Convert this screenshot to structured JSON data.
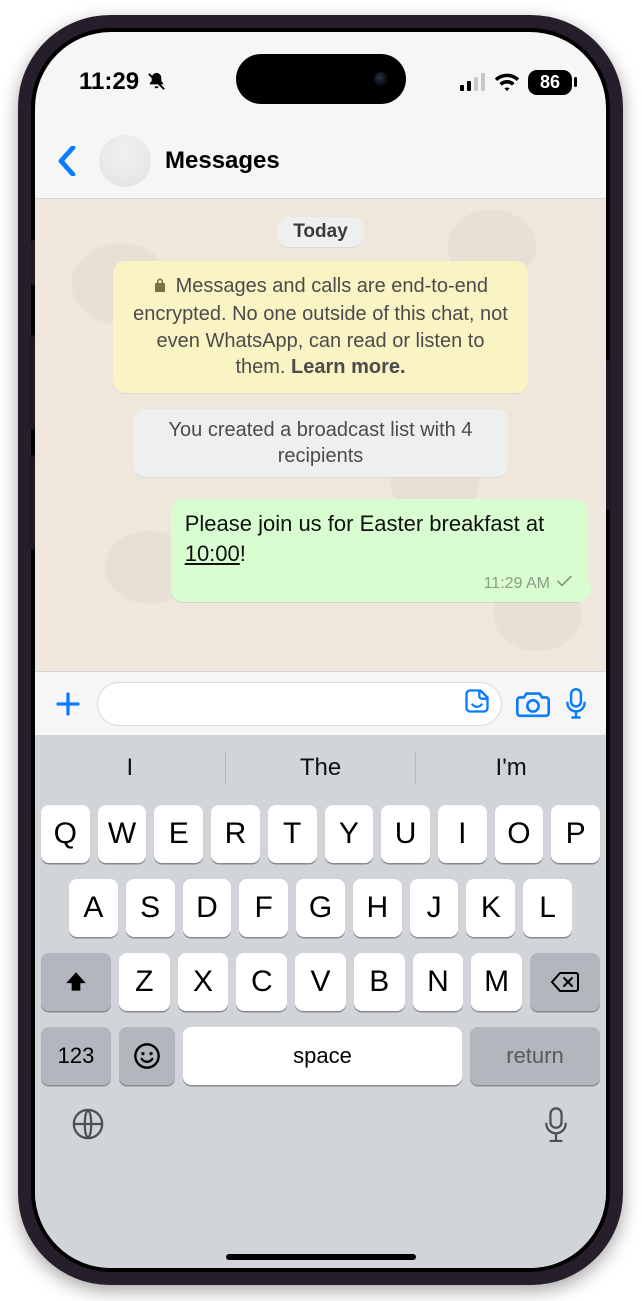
{
  "status": {
    "time": "11:29",
    "battery": "86"
  },
  "header": {
    "title": "Messages"
  },
  "chat": {
    "day_label": "Today",
    "encryption_text": "Messages and calls are end-to-end encrypted. No one outside of this chat, not even WhatsApp, can read or listen to them.",
    "encryption_learn_more": "Learn more.",
    "system_message": "You created a broadcast list with 4 recipients",
    "out_msg_pre": "Please join us for Easter breakfast at ",
    "out_msg_time_link": "10:00",
    "out_msg_post": "!",
    "out_msg_timestamp": "11:29 AM"
  },
  "composer": {
    "placeholder": ""
  },
  "keyboard": {
    "suggestions": [
      "I",
      "The",
      "I'm"
    ],
    "row1": [
      "Q",
      "W",
      "E",
      "R",
      "T",
      "Y",
      "U",
      "I",
      "O",
      "P"
    ],
    "row2": [
      "A",
      "S",
      "D",
      "F",
      "G",
      "H",
      "J",
      "K",
      "L"
    ],
    "row3": [
      "Z",
      "X",
      "C",
      "V",
      "B",
      "N",
      "M"
    ],
    "numeric_label": "123",
    "space_label": "space",
    "return_label": "return"
  }
}
